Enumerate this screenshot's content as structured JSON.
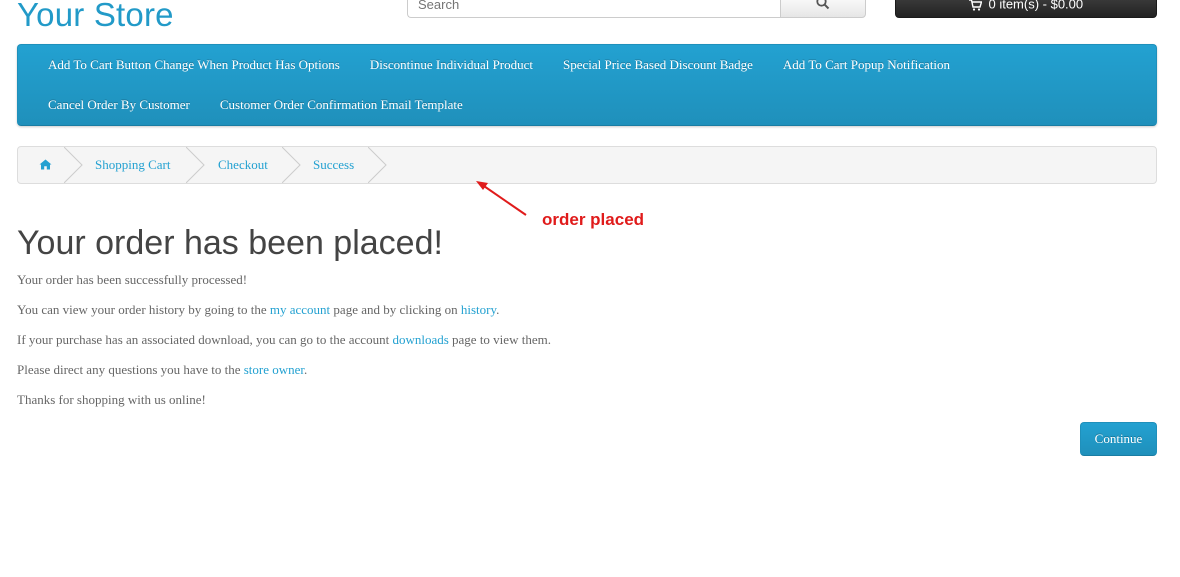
{
  "header": {
    "logo": "Your Store",
    "search": {
      "placeholder": "Search",
      "icon": "search-icon"
    },
    "cart": {
      "label": "0 item(s) - $0.00",
      "icon": "shopping-cart-icon"
    }
  },
  "menu": {
    "row1": [
      "Add To Cart Button Change When Product Has Options",
      "Discontinue Individual Product",
      "Special Price Based Discount Badge",
      "Add To Cart Popup Notification"
    ],
    "row2": [
      "Cancel Order By Customer",
      "Customer Order Confirmation Email Template"
    ]
  },
  "breadcrumb": {
    "home_icon": "home-icon",
    "items": [
      "Shopping Cart",
      "Checkout",
      "Success"
    ]
  },
  "annotation": {
    "text": "order placed",
    "color": "#e01b1b"
  },
  "content": {
    "title": "Your order has been placed!",
    "p1": "Your order has been successfully processed!",
    "p2": {
      "before": "You can view your order history by going to the ",
      "link1": "my account",
      "middle": " page and by clicking on ",
      "link2": "history",
      "after": "."
    },
    "p3": {
      "before": "If your purchase has an associated download, you can go to the account ",
      "link": "downloads",
      "after": " page to view them."
    },
    "p4": {
      "before": "Please direct any questions you have to the ",
      "link": "store owner",
      "after": "."
    },
    "p5": "Thanks for shopping with us online!",
    "continue_label": "Continue"
  },
  "colors": {
    "accent": "#23a1d1",
    "text": "#666666",
    "heading": "#444444"
  }
}
